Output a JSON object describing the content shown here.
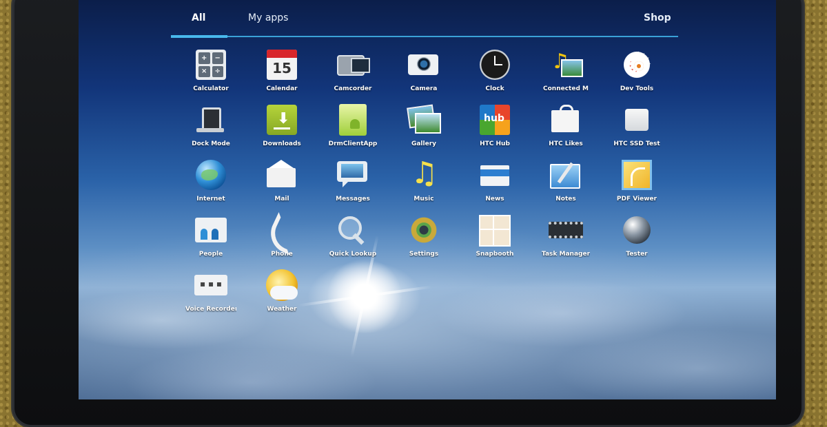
{
  "tabs": {
    "all": "All",
    "my_apps": "My apps",
    "shop": "Shop"
  },
  "apps": {
    "calculator": {
      "label": "Calculator",
      "icon": "calculator-icon"
    },
    "calendar": {
      "label": "Calendar",
      "icon": "calendar-icon",
      "day": "15"
    },
    "camcorder": {
      "label": "Camcorder",
      "icon": "camcorder-icon"
    },
    "camera": {
      "label": "Camera",
      "icon": "camera-icon"
    },
    "clock": {
      "label": "Clock",
      "icon": "clock-icon"
    },
    "connected_media": {
      "label": "Connected M",
      "icon": "connected-media-icon"
    },
    "dev_tools": {
      "label": "Dev Tools",
      "icon": "dev-tools-icon"
    },
    "dock_mode": {
      "label": "Dock Mode",
      "icon": "dock-icon"
    },
    "downloads": {
      "label": "Downloads",
      "icon": "download-icon"
    },
    "drm_client": {
      "label": "DrmClientApp",
      "icon": "android-icon"
    },
    "gallery": {
      "label": "Gallery",
      "icon": "gallery-icon"
    },
    "htc_hub": {
      "label": "HTC Hub",
      "icon": "htc-hub-icon",
      "glyph": "hub"
    },
    "htc_likes": {
      "label": "HTC Likes",
      "icon": "shopping-bag-icon"
    },
    "htc_ssd": {
      "label": "HTC SSD Test",
      "icon": "ssd-test-icon"
    },
    "internet": {
      "label": "Internet",
      "icon": "globe-icon"
    },
    "mail": {
      "label": "Mail",
      "icon": "mail-icon"
    },
    "messages": {
      "label": "Messages",
      "icon": "messages-icon"
    },
    "music": {
      "label": "Music",
      "icon": "music-note-icon"
    },
    "news": {
      "label": "News",
      "icon": "news-icon"
    },
    "notes": {
      "label": "Notes",
      "icon": "notes-icon"
    },
    "pdf_viewer": {
      "label": "PDF Viewer",
      "icon": "pdf-icon"
    },
    "people": {
      "label": "People",
      "icon": "people-icon"
    },
    "phone": {
      "label": "Phone",
      "icon": "phone-icon"
    },
    "quick_lookup": {
      "label": "Quick Lookup",
      "icon": "magnifier-icon"
    },
    "settings": {
      "label": "Settings",
      "icon": "settings-gear-icon"
    },
    "snapbooth": {
      "label": "Snapbooth",
      "icon": "snapbooth-icon"
    },
    "task_manager": {
      "label": "Task Manager",
      "icon": "chip-icon"
    },
    "tester": {
      "label": "Tester",
      "icon": "sphere-icon"
    },
    "voice_recorder": {
      "label": "Voice Recorder",
      "icon": "recorder-icon"
    },
    "weather": {
      "label": "Weather",
      "icon": "weather-icon"
    }
  },
  "colors": {
    "tab_accent": "#3aa2d8",
    "label_text": "#ffffff"
  }
}
